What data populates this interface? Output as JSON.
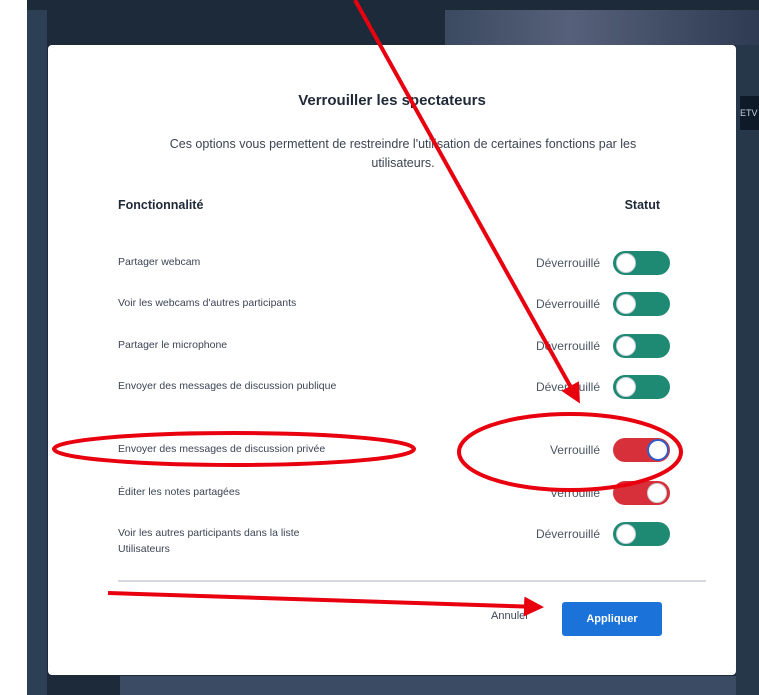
{
  "backdrop": {
    "video_tag": "ETV"
  },
  "dialog": {
    "title": "Verrouiller les spectateurs",
    "description": "Ces options vous permettent de restreindre l'utilisation de certaines fonctions par les utilisateurs.",
    "feature_header": "Fonctionnalité",
    "status_header": "Statut",
    "rows": [
      {
        "label": "Partager webcam",
        "status": "Déverrouillé",
        "locked": false
      },
      {
        "label": "Voir les webcams d'autres participants",
        "status": "Déverrouillé",
        "locked": false
      },
      {
        "label": "Partager le microphone",
        "status": "Déverrouillé",
        "locked": false
      },
      {
        "label": "Envoyer des messages de discussion publique",
        "status": "Déverrouillé",
        "locked": false
      },
      {
        "label": "Envoyer des messages de discussion privée",
        "status": "Verrouillé",
        "locked": true
      },
      {
        "label": "Éditer les notes partagées",
        "status": "Verrouillé",
        "locked": true
      },
      {
        "label": "Voir les autres participants dans la liste Utilisateurs",
        "status": "Déverrouillé",
        "locked": false
      }
    ],
    "cancel_label": "Annuler",
    "apply_label": "Appliquer"
  },
  "colors": {
    "unlocked_toggle": "#1e8a73",
    "locked_toggle": "#d8303a",
    "primary_button": "#1b72d9",
    "annotation": "#e8000f"
  },
  "icons": {
    "annotation_arrows": "arrow-icon",
    "annotation_ellipses": "highlight-ellipse"
  }
}
